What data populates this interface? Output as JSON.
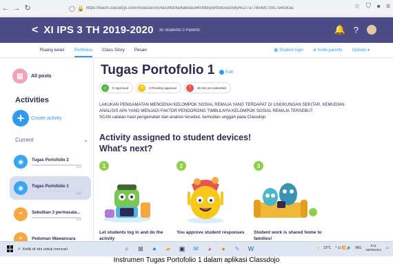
{
  "browser": {
    "url": "https://teach.classdojo.com/#/classes/5c4acd4dc6a4a6ea5a4fc89e/portfolio/activity/6127a778549c73917a4c9cac",
    "icons": [
      "back-arrow",
      "forward-arrow",
      "reload-icon",
      "shield-icon",
      "lock-icon",
      "star-icon",
      "extensions-icon",
      "menu-icon"
    ]
  },
  "classbar": {
    "back_glyph": "<",
    "class_name": "XI IPS 3 TH 2019-2020",
    "meta": "35 Students   0 Parents"
  },
  "tabs": [
    {
      "label": "Ruang kelas"
    },
    {
      "label": "Portfolios",
      "active": true
    },
    {
      "label": "Class Story"
    },
    {
      "label": "Pesan"
    }
  ],
  "tab_actions": {
    "student_login": "Student login",
    "invite_parents": "Invite parents",
    "options": "Options"
  },
  "sidebar": {
    "all_posts": "All posts",
    "activities_heading": "Activities",
    "create_activity": "Create activity",
    "current_label": "Current",
    "items": [
      {
        "title": "Tugas Portofolio 2",
        "count": "0/35"
      },
      {
        "title": "Tugas Portofolio 1",
        "count": "0/35"
      },
      {
        "title": "Sebutkan 3 permasala...",
        "count": "0/35"
      },
      {
        "title": "Pedoman Wawancara",
        "count": ""
      }
    ]
  },
  "main": {
    "title": "Tugas Portofolio 1",
    "edit_label": "Edit",
    "badges": [
      {
        "label": "0 Approved"
      },
      {
        "label": "0 Pending approval"
      },
      {
        "label": "35 Not yet submitted"
      }
    ],
    "description_lines": [
      "LAKUKAN PENGAMATAN MENGENAI KELOMPOK SOSIAL REMAJA YANG TERDAPAT DI LINGKUNGAN SEKITAR, KEMUDIAN",
      "ANALISIS APA YANG MENJADI FAKTOR PENDORONG TIMBULNYA KELOMPOK SOSIAL REMAJA TERSEBUT",
      "SCAN catatan hasil pengamatan dan analisis tersebut, kemudian unggah pada Classdojo"
    ],
    "heading_line1": "Activity assigned to student devices!",
    "heading_line2": "What's next?",
    "steps": [
      {
        "num": "1",
        "text": "Let students log in and do the activity"
      },
      {
        "num": "2",
        "text": "You approve student responses"
      },
      {
        "num": "3",
        "text": "Student work is shared home to families!"
      }
    ]
  },
  "taskbar": {
    "search_placeholder": "Ketik di sini untuk mencari",
    "weather": "23°C",
    "lang": "ING",
    "time": "9:11",
    "date": "28/08/2021"
  },
  "caption": "Instrumen Tugas Portofolio 1 dalam aplikasi Classdojo",
  "colors": {
    "header_bg": "#4b4b86",
    "accent_blue": "#2d9bf0",
    "step_green": "#8dd04b"
  }
}
